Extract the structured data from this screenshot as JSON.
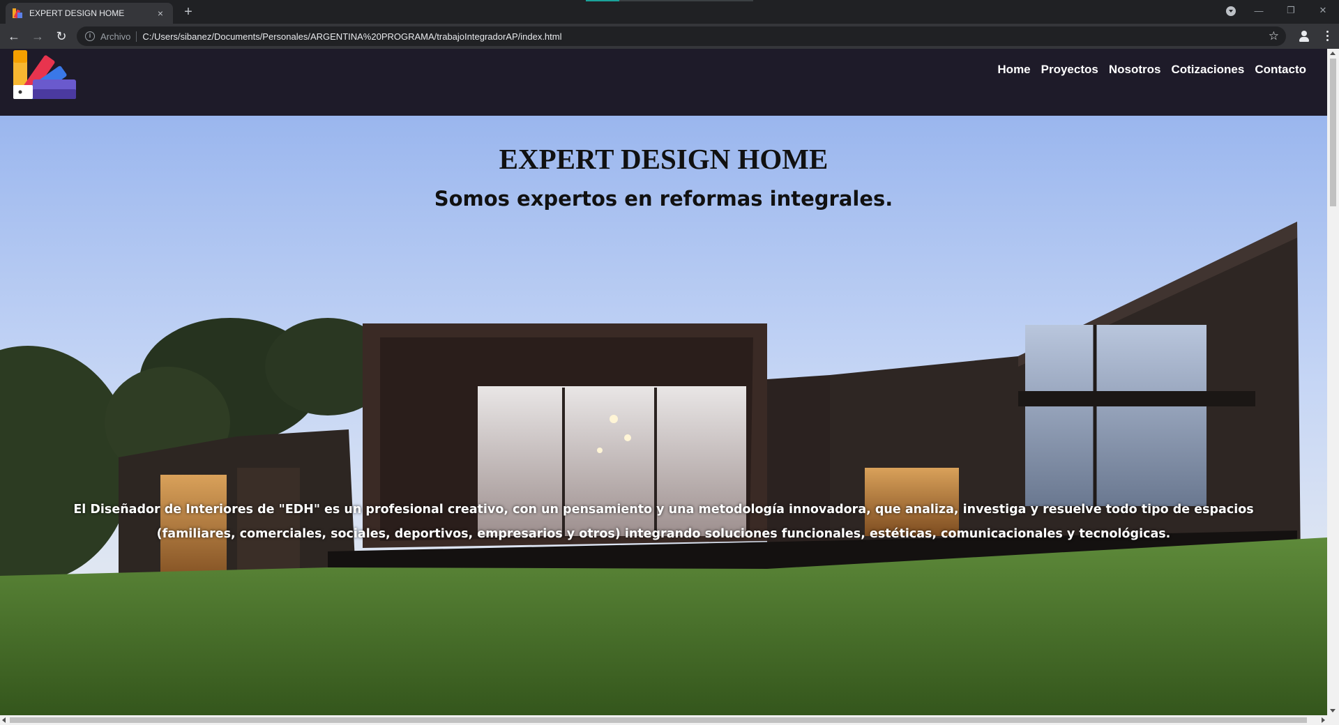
{
  "browser": {
    "tab_title": "EXPERT DESIGN HOME",
    "tab_close": "×",
    "new_tab": "+",
    "url_scheme_label": "Archivo",
    "url": "C:/Users/sibanez/Documents/Personales/ARGENTINA%20PROGRAMA/trabajoIntegradorAP/index.html",
    "back": "←",
    "forward": "→",
    "reload": "↻",
    "bookmark": "☆",
    "minimize": "—",
    "restore": "❐",
    "close": "✕"
  },
  "site": {
    "nav": [
      "Home",
      "Proyectos",
      "Nosotros",
      "Cotizaciones",
      "Contacto"
    ],
    "hero": {
      "title": "EXPERT DESIGN HOME",
      "subtitle": "Somos expertos en reformas integrales.",
      "description": "El Diseñador de Interiores de \"EDH\" es un profesional creativo, con un pensamiento y una metodología innovadora, que analiza, investiga y resuelve todo tipo de espacios (familiares, comerciales, sociales, deportivos, empresarios y otros) integrando soluciones funcionales, estéticas, comunicacionales y tecnológicas."
    }
  },
  "colors": {
    "header_bg": "#1e1b29",
    "nav_text": "#ffffff",
    "sky_top": "#9ab6ee",
    "grass": "#4a7a2c"
  }
}
